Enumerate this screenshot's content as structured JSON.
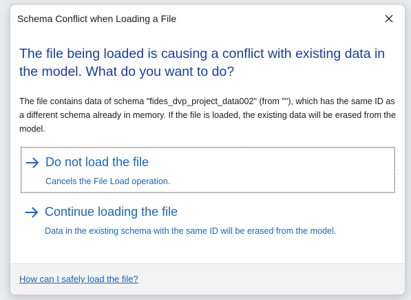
{
  "window": {
    "title": "Schema Conflict when Loading a File",
    "close_icon": "close-icon"
  },
  "main_instruction": "The file being loaded is causing a conflict with existing data in the model. What do you want to do?",
  "content": "The file contains data of schema \"fides_dvp_project_data002\" (from \"\"), which has the same ID as a different schema already in memory. If the file is loaded, the existing data will be erased from the model.",
  "commands": [
    {
      "title": "Do not load the file",
      "description": "Cancels the File Load operation.",
      "icon": "arrow-right-icon",
      "focused": true
    },
    {
      "title": "Continue loading the file",
      "description": "Data in the existing schema with the same ID will be erased from the model.",
      "icon": "arrow-right-icon",
      "focused": false
    }
  ],
  "footer": {
    "help_link": "How can I safely load the file?"
  },
  "colors": {
    "instruction": "#1b3d9a",
    "link": "#1b64b4",
    "footer_bg": "#f3f3f3"
  }
}
